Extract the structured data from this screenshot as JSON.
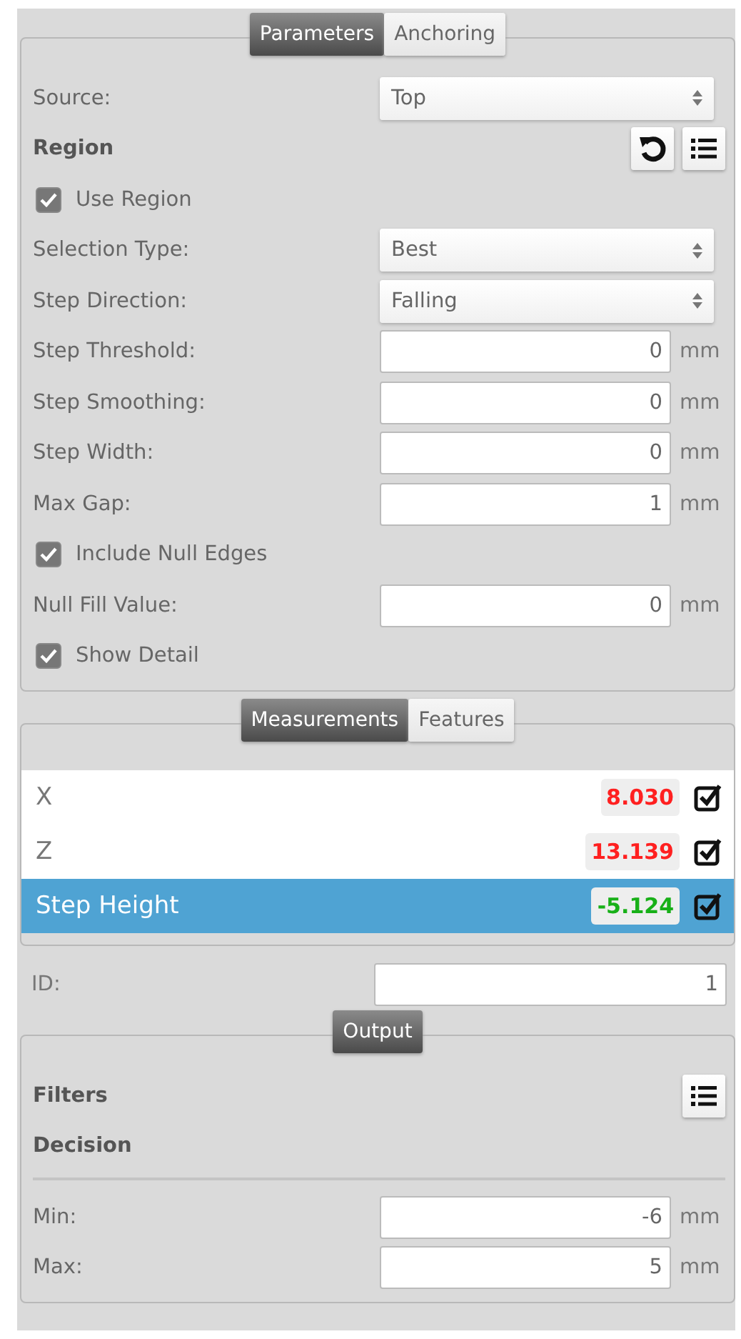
{
  "parameters_panel": {
    "tabs": [
      {
        "label": "Parameters",
        "selected": true
      },
      {
        "label": "Anchoring",
        "selected": false
      }
    ],
    "rows": [
      {
        "kind": "select",
        "label": "Source:",
        "value": "Top"
      },
      {
        "kind": "heading",
        "label": "Region",
        "buttons": [
          {
            "kind": "reset"
          },
          {
            "kind": "list"
          }
        ]
      },
      {
        "kind": "checkbox",
        "label": "Use Region",
        "checked": true
      },
      {
        "kind": "select",
        "label": "Selection Type:",
        "value": "Best"
      },
      {
        "kind": "select",
        "label": "Step Direction:",
        "value": "Falling"
      },
      {
        "kind": "input",
        "label": "Step Threshold:",
        "value": "0",
        "unit": "mm"
      },
      {
        "kind": "input",
        "label": "Step Smoothing:",
        "value": "0",
        "unit": "mm"
      },
      {
        "kind": "input",
        "label": "Step Width:",
        "value": "0",
        "unit": "mm"
      },
      {
        "kind": "input",
        "label": "Max Gap:",
        "value": "1",
        "unit": "mm"
      },
      {
        "kind": "checkbox",
        "label": "Include Null Edges",
        "checked": true
      },
      {
        "kind": "input",
        "label": "Null Fill Value:",
        "value": "0",
        "unit": "mm"
      },
      {
        "kind": "checkbox",
        "label": "Show Detail",
        "checked": true
      }
    ]
  },
  "measurements_panel": {
    "tabs": [
      {
        "label": "Measurements",
        "selected": true
      },
      {
        "label": "Features",
        "selected": false
      }
    ],
    "items": [
      {
        "name": "X",
        "value": "8.030",
        "color": "#ff2020",
        "checked": true,
        "selected": false
      },
      {
        "name": "Z",
        "value": "13.139",
        "color": "#ff2020",
        "checked": true,
        "selected": false
      },
      {
        "name": "Step Height",
        "value": "-5.124",
        "color": "#18b018",
        "checked": true,
        "selected": true
      }
    ]
  },
  "id_field": {
    "label": "ID:",
    "value": "1"
  },
  "output_panel": {
    "tabs": [
      {
        "label": "Output",
        "selected": true
      }
    ],
    "rows": [
      {
        "kind": "heading",
        "label": "Filters",
        "buttons": [
          {
            "kind": "list"
          }
        ]
      },
      {
        "kind": "heading",
        "label": "Decision"
      },
      {
        "kind": "divider"
      },
      {
        "kind": "input",
        "label": "Min:",
        "value": "-6",
        "unit": "mm"
      },
      {
        "kind": "input",
        "label": "Max:",
        "value": "5",
        "unit": "mm"
      }
    ]
  }
}
